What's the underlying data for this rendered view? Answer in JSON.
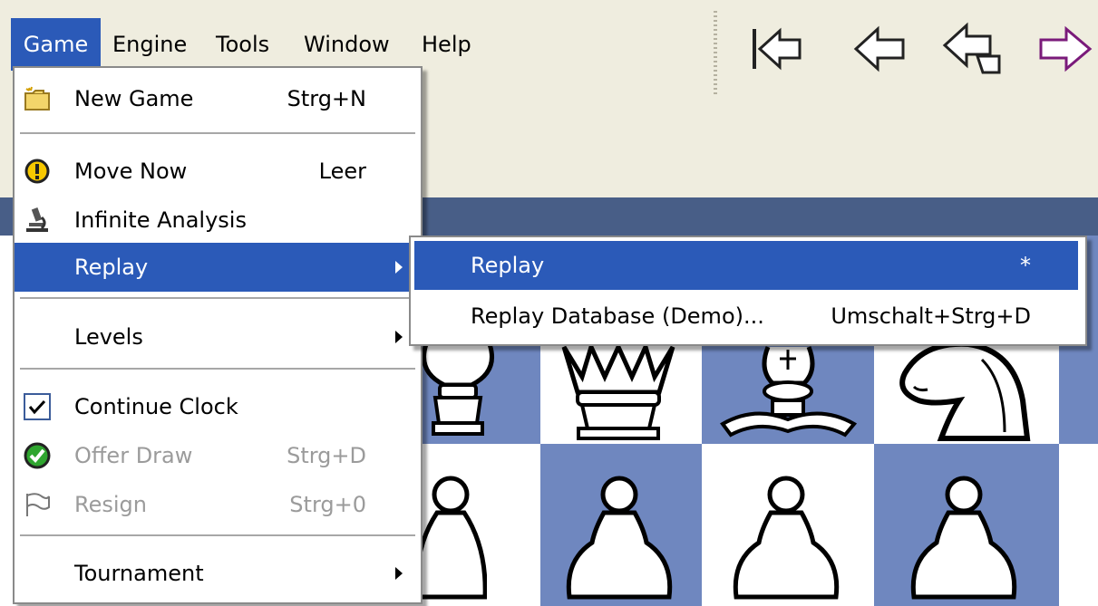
{
  "menubar": {
    "items": [
      "Game",
      "Engine",
      "Tools",
      "Window",
      "Help"
    ],
    "active": "Game"
  },
  "game_menu": {
    "new_game": {
      "label": "New Game",
      "shortcut": "Strg+N"
    },
    "move_now": {
      "label": "Move Now",
      "shortcut": "Leer"
    },
    "infinite_analysis": {
      "label": "Infinite Analysis"
    },
    "replay": {
      "label": "Replay"
    },
    "levels": {
      "label": "Levels"
    },
    "continue_clock": {
      "label": "Continue Clock",
      "checked": true
    },
    "offer_draw": {
      "label": "Offer Draw",
      "shortcut": "Strg+D",
      "disabled": true
    },
    "resign": {
      "label": "Resign",
      "shortcut": "Strg+0",
      "disabled": true
    },
    "tournament": {
      "label": "Tournament"
    }
  },
  "replay_submenu": {
    "replay": {
      "label": "Replay",
      "shortcut": "*"
    },
    "replay_database": {
      "label": "Replay Database (Demo)...",
      "shortcut": "Umschalt+Strg+D"
    }
  },
  "toolbar": {
    "icons": [
      "go-to-start-icon",
      "back-icon",
      "take-back-icon",
      "forward-icon"
    ]
  },
  "colors": {
    "highlight": "#2b5ab8",
    "menubar_bg": "#efeddf",
    "board_dark": "#6f87bf",
    "board_light": "#ffffff",
    "title_bar": "#485e87"
  }
}
